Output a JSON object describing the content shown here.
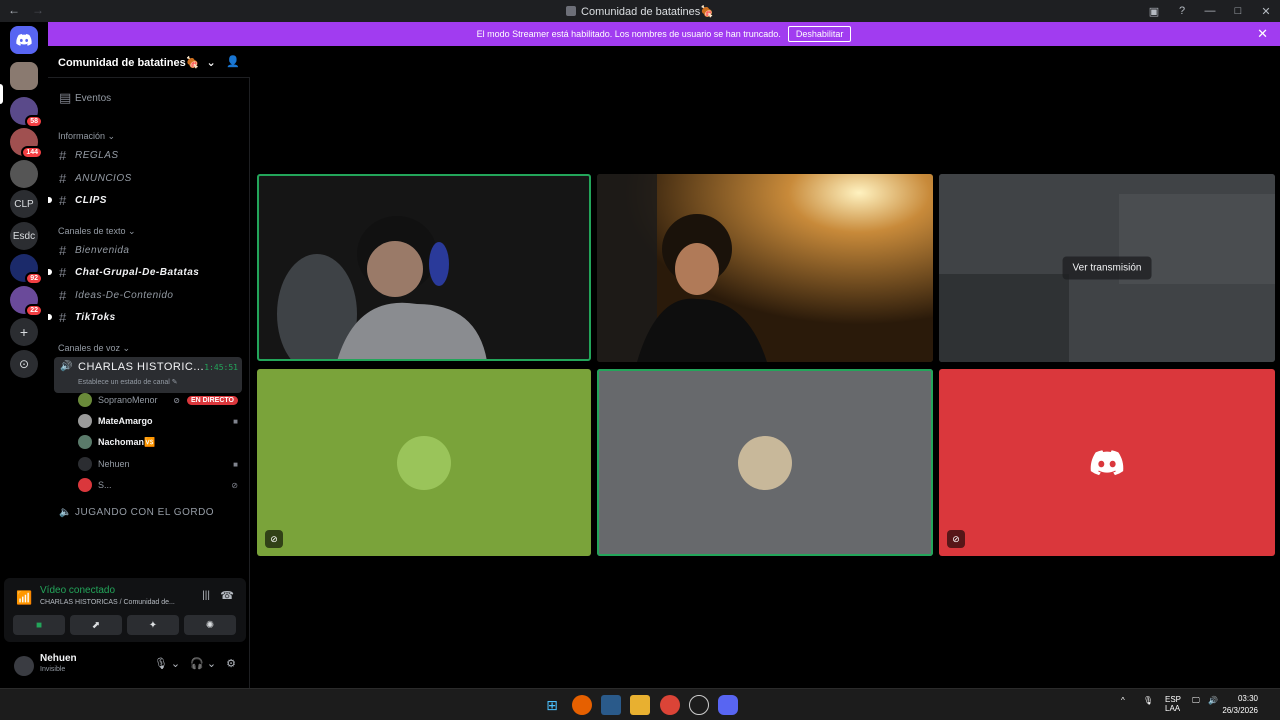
{
  "window": {
    "title": "Comunidad de batatines🍖",
    "nav_back": "←",
    "nav_forward": "→",
    "controls": [
      "▣",
      "?",
      "—",
      "□",
      "✕"
    ]
  },
  "streamer_banner": {
    "text": "El modo Streamer está habilitado. Los nombres de usuario se han truncado.",
    "button": "Deshabilitar",
    "close": "✕"
  },
  "guilds": [
    {
      "label": "",
      "badge": ""
    },
    {
      "label": "",
      "badge": "58"
    },
    {
      "label": "",
      "badge": "144"
    },
    {
      "label": "",
      "badge": ""
    },
    {
      "label": "CLP",
      "badge": ""
    },
    {
      "label": "Esdc",
      "badge": ""
    },
    {
      "label": "",
      "badge": "92"
    },
    {
      "label": "",
      "badge": "22"
    },
    {
      "label": "+",
      "badge": ""
    },
    {
      "label": "⊙",
      "badge": ""
    }
  ],
  "server": {
    "name": "Comunidad de batatines🍖",
    "chevron": "⌄",
    "add_icon": "👤",
    "events": "Eventos",
    "categories": {
      "info": "Información ⌄",
      "text": "Canales de texto ⌄",
      "voice": "Canales de voz ⌄"
    },
    "info_channels": [
      "REGLAS",
      "ANUNCIOS",
      "CLIPS"
    ],
    "text_channels": [
      "Bienvenida",
      "Chat-Grupal-De-Batatas",
      "Ideas-De-Contenido",
      "TikToks"
    ],
    "voice_active": {
      "name": "CHARLAS HISTORIC...",
      "timer": "1:45:51",
      "status": "Establece un estado de canal ✎"
    },
    "voice_users": [
      {
        "name": "SopranoMenor",
        "right": "EN DIRECTO",
        "live": true,
        "color": "#6a8a3a"
      },
      {
        "name": "MateAmargo",
        "right": "■",
        "live": false,
        "color": "#9a9a9a"
      },
      {
        "name": "Nachoman🆚",
        "right": "",
        "live": false,
        "color": "#5a7a6a"
      },
      {
        "name": "Nehuen",
        "right": "■",
        "live": false,
        "color": "#2b2d31"
      },
      {
        "name": "S...",
        "right": "⊘",
        "live": false,
        "color": "#da373c"
      }
    ],
    "voice_other": "JUGANDO CON EL GORDO"
  },
  "voice_panel": {
    "status": "Vídeo conectado",
    "channel": "CHARLAS HISTORICAS / Comunidad de...",
    "wave_icon": "|||",
    "hang_icon": "☎",
    "buttons": [
      "■",
      "⬈",
      "✦",
      "✺"
    ]
  },
  "user_panel": {
    "name": "Nehuen",
    "status": "Invisible",
    "mic": "🎙 ⌄",
    "headset": "🎧 ⌄",
    "settings": "⚙"
  },
  "tiles": [
    {
      "type": "video",
      "bg": "#1a1a1a"
    },
    {
      "type": "video",
      "bg": "#3a2a15"
    },
    {
      "type": "stream",
      "bg": "#3c3f42",
      "label": "Ver transmisión"
    },
    {
      "type": "avatar",
      "bg": "#7aa33a",
      "muted": true
    },
    {
      "type": "avatar",
      "bg": "#67696c",
      "muted": false
    },
    {
      "type": "discord",
      "bg": "#da373c",
      "muted": true
    }
  ],
  "taskbar": {
    "tray_lang_1": "ESP",
    "tray_lang_2": "LAA",
    "time": "03:30",
    "date": "26/3/2026"
  }
}
